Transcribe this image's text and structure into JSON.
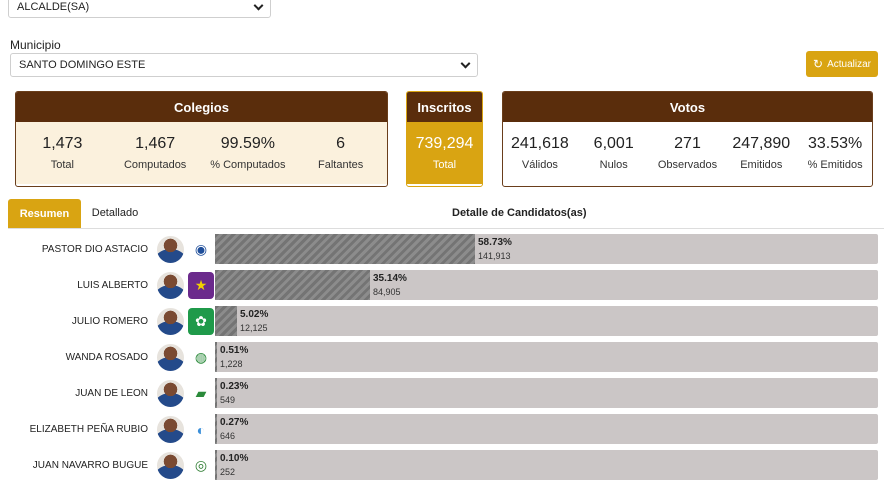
{
  "filters": {
    "cargo": "ALCALDE(SA)",
    "municipio_label": "Municipio",
    "municipio": "SANTO DOMINGO ESTE",
    "refresh_label": "Actualizar"
  },
  "colegios": {
    "title": "Colegios",
    "stats": [
      {
        "value": "1,473",
        "label": "Total"
      },
      {
        "value": "1,467",
        "label": "Computados"
      },
      {
        "value": "99.59%",
        "label": "% Computados"
      },
      {
        "value": "6",
        "label": "Faltantes"
      }
    ]
  },
  "inscritos": {
    "title": "Inscritos",
    "value": "739,294",
    "label": "Total"
  },
  "votos": {
    "title": "Votos",
    "stats": [
      {
        "value": "241,618",
        "label": "Válidos"
      },
      {
        "value": "6,001",
        "label": "Nulos"
      },
      {
        "value": "271",
        "label": "Observados"
      },
      {
        "value": "247,890",
        "label": "Emitidos"
      },
      {
        "value": "33.53%",
        "label": "% Emitidos"
      }
    ]
  },
  "tabs": {
    "resumen": "Resumen",
    "detallado": "Detallado",
    "detalle_title": "Detalle de Candidatos(as)"
  },
  "candidates": [
    {
      "name": "PASTOR DIO ASTACIO",
      "pct": "58.73%",
      "votes": "141,913",
      "share": 58.73,
      "party_icon": "prm-logo-icon",
      "party_bg": "#ffffff",
      "party_color": "#1f4e9a",
      "glyph": "◉"
    },
    {
      "name": "LUIS ALBERTO",
      "pct": "35.14%",
      "votes": "84,905",
      "share": 35.14,
      "party_icon": "pld-star-icon",
      "party_bg": "#6b2a8c",
      "party_color": "#f2d100",
      "glyph": "★"
    },
    {
      "name": "JULIO ROMERO",
      "pct": "5.02%",
      "votes": "12,125",
      "share": 5.02,
      "party_icon": "fp-logo-icon",
      "party_bg": "#1f9a4a",
      "party_color": "#ffffff",
      "glyph": "✿"
    },
    {
      "name": "WANDA ROSADO",
      "pct": "0.51%",
      "votes": "1,228",
      "share": 0.51,
      "party_icon": "party-torch-icon",
      "party_bg": "#ffffff",
      "party_color": "#2a8a3a",
      "glyph": "◍"
    },
    {
      "name": "JUAN DE LEON",
      "pct": "0.23%",
      "votes": "549",
      "share": 0.23,
      "party_icon": "party-map-icon",
      "party_bg": "#ffffff",
      "party_color": "#2a8a3a",
      "glyph": "▰"
    },
    {
      "name": "ELIZABETH PEÑA RUBIO",
      "pct": "0.27%",
      "votes": "646",
      "share": 0.27,
      "party_icon": "party-circle-icon",
      "party_bg": "#ffffff",
      "party_color": "#3b8fd9",
      "glyph": "◐"
    },
    {
      "name": "JUAN NAVARRO BUGUE",
      "pct": "0.10%",
      "votes": "252",
      "share": 0.1,
      "party_icon": "party-globe-icon",
      "party_bg": "#ffffff",
      "party_color": "#2e7d32",
      "glyph": "◎"
    }
  ]
}
